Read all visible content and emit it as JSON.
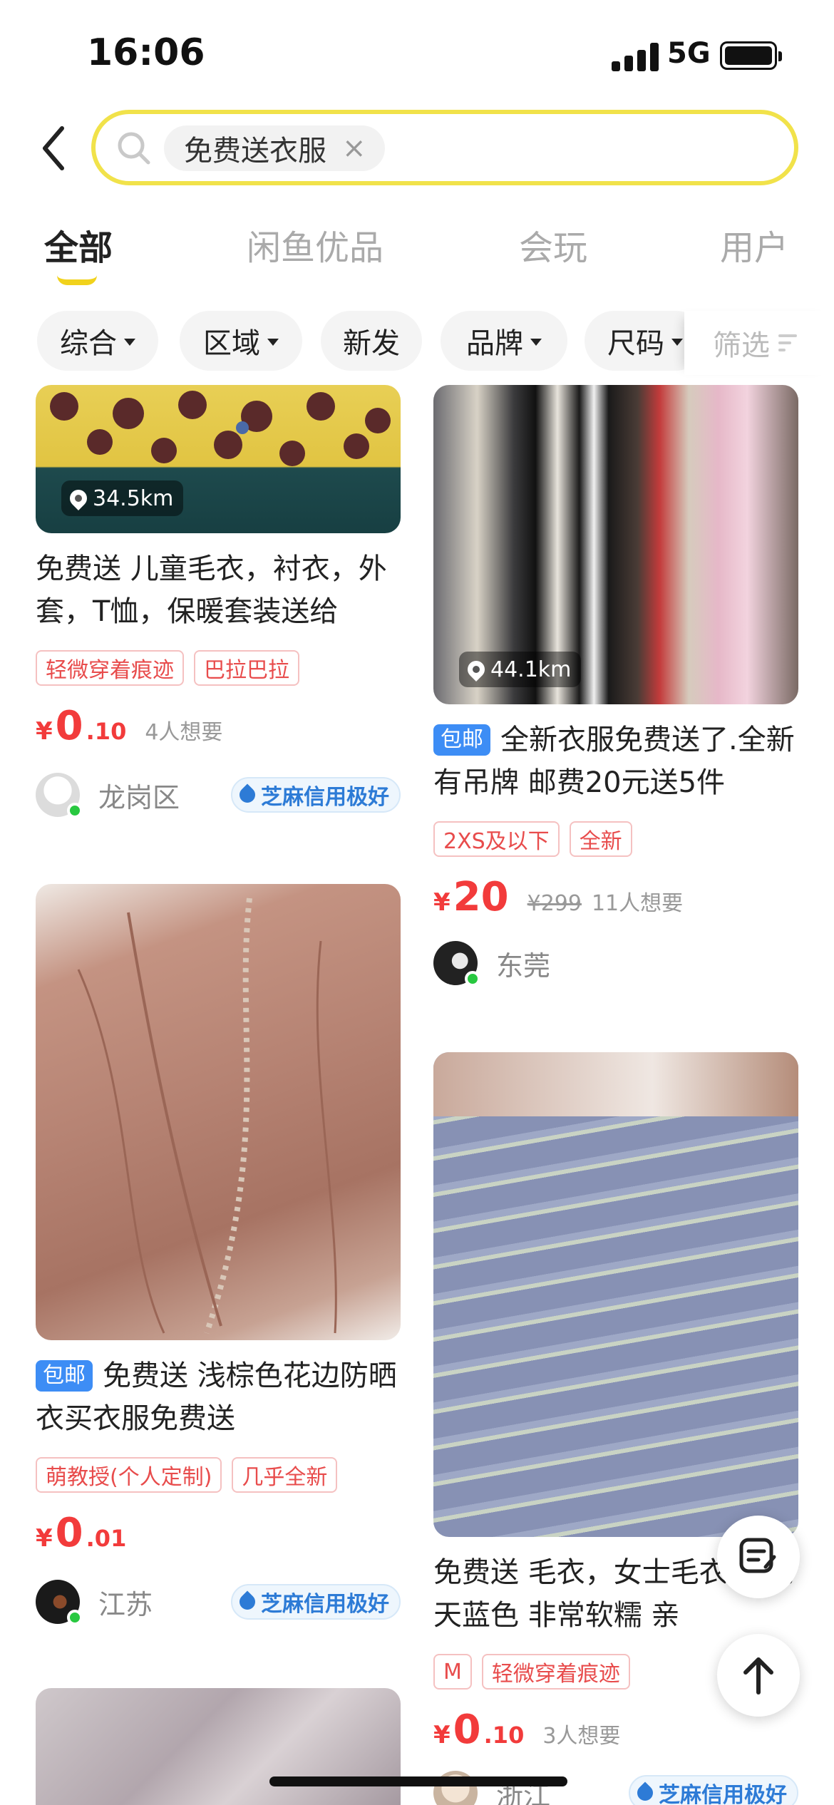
{
  "status_bar": {
    "time": "16:06",
    "network": "5G"
  },
  "search": {
    "query": "免费送衣服",
    "clear_symbol": "×"
  },
  "tabs": [
    {
      "label": "全部",
      "active": true
    },
    {
      "label": "闲鱼优品",
      "active": false
    },
    {
      "label": "会玩",
      "active": false
    },
    {
      "label": "用户",
      "active": false
    }
  ],
  "filters": [
    {
      "label": "综合",
      "has_dropdown": true
    },
    {
      "label": "区域",
      "has_dropdown": true
    },
    {
      "label": "新发",
      "has_dropdown": false
    },
    {
      "label": "品牌",
      "has_dropdown": true
    },
    {
      "label": "尺码",
      "has_dropdown": true
    }
  ],
  "filter_button": "筛选",
  "listings": [
    {
      "distance": "34.5km",
      "title": "免费送 儿童毛衣，衬衣，外套，T恤，保暖套装送给",
      "tags": [
        "轻微穿着痕迹",
        "巴拉巴拉"
      ],
      "price_symbol": "¥",
      "price_int": "0",
      "price_dec": ".10",
      "want": "4人想要",
      "location": "龙岗区",
      "credit": "芝麻信用极好"
    },
    {
      "distance": "44.1km",
      "badge": "包邮",
      "title": "全新衣服免费送了.全新有吊牌  邮费20元送5件",
      "tags": [
        "2XS及以下",
        "全新"
      ],
      "price_symbol": "¥",
      "price_int": "20",
      "original_price": "¥299",
      "want": "11人想要",
      "location": "东莞"
    },
    {
      "badge": "包邮",
      "title": "免费送 浅棕色花边防晒衣买衣服免费送",
      "tags": [
        "萌教授(个人定制)",
        "几乎全新"
      ],
      "price_symbol": "¥",
      "price_int": "0",
      "price_dec": ".01",
      "location": "江苏",
      "credit": "芝麻信用极好"
    },
    {
      "title": "免费送 毛衣，女士毛衣 马毛  天蓝色 非常软糯 亲",
      "tags": [
        "M",
        "轻微穿着痕迹"
      ],
      "price_symbol": "¥",
      "price_int": "0",
      "price_dec": ".10",
      "want": "3人想要",
      "location": "浙江",
      "credit": "芝麻信用极好"
    }
  ],
  "colors": {
    "accent_yellow": "#f1e24a",
    "price_red": "#f23b3b",
    "badge_blue": "#3d8df5",
    "credit_blue": "#2d7bd6"
  }
}
